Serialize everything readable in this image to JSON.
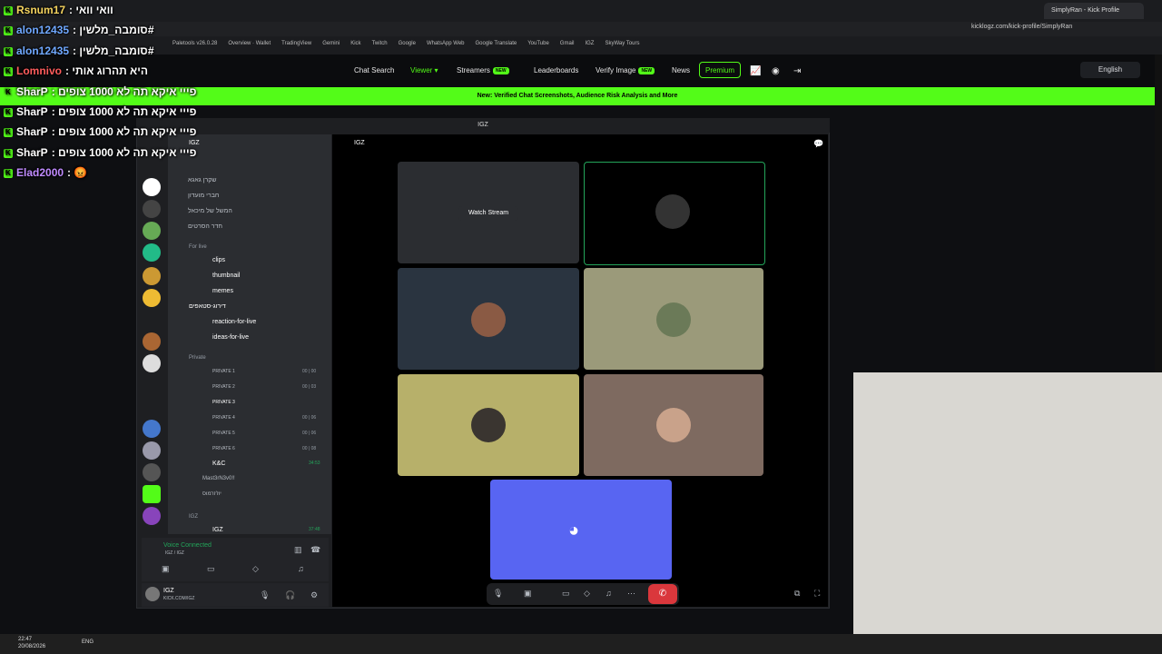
{
  "browser": {
    "tab_title": "SimplyRan - Kick Profile",
    "url": "kicklogz.com/kick-profile/SimplyRan",
    "bookmarks": [
      "Paletools v26.0.28",
      "Overview · Wallet",
      "TradingView",
      "Gemini",
      "Kick",
      "Twitch",
      "Google",
      "WhatsApp Web",
      "Google Translate",
      "YouTube",
      "Gmail",
      "IGZ",
      "SkyWay Tours"
    ]
  },
  "kick_nav": {
    "items": [
      "Chat Search",
      "Viewer",
      "Streamers",
      "Leaderboards",
      "Verify Image",
      "News"
    ],
    "new_badge": "NEW",
    "premium": "Premium",
    "language": "English",
    "banner": "New: Verified Chat Screenshots, Audience Risk Analysis and More"
  },
  "chat": [
    {
      "user": "Rsnum17",
      "message": "וואי וואי",
      "color": "#f4d35e"
    },
    {
      "user": "alon12435",
      "message": "סומבה_מלשין#",
      "color": "#6fa8ff"
    },
    {
      "user": "alon12435",
      "message": "סומבה_מלשין#",
      "color": "#6fa8ff"
    },
    {
      "user": "Lomnivo",
      "message": "היא תהרוג אותי",
      "color": "#ff5c5c"
    },
    {
      "user": "SharP",
      "message": "פייי איקא תה לא 1000 צופים",
      "color": "#ffffff"
    },
    {
      "user": "SharP",
      "message": "פייי איקא תה לא 1000 צופים",
      "color": "#ffffff"
    },
    {
      "user": "SharP",
      "message": "פייי איקא תה לא 1000 צופים",
      "color": "#ffffff"
    },
    {
      "user": "SharP",
      "message": "פייי איקא תה לא 1000 צופים",
      "color": "#ffffff"
    },
    {
      "user": "Elad2000",
      "message": "😡",
      "color": "#c08bff"
    }
  ],
  "discord": {
    "window_title": "IGZ",
    "server_name": "IGZ",
    "channel_header": "IGZ",
    "categories": {
      "live": "For live",
      "private": "Private",
      "igz": "IGZ"
    },
    "top_channels": [
      "שקרן גאגא",
      "חברי מועדון",
      "המשל של מיכאל",
      "חדר הסרטים"
    ],
    "text_channels": [
      "clips",
      "thumbnail",
      "memes",
      "דירוג-סטאפים",
      "reaction-for-live",
      "ideas-for-live"
    ],
    "private_channels": [
      {
        "name": "PRIVATE 1",
        "count": "00 | 00"
      },
      {
        "name": "PRIVATE 2",
        "count": "00 | 03"
      },
      {
        "name": "PRIVATE 3",
        "count": ""
      },
      {
        "name": "PRIVATE 4",
        "count": "00 | 06"
      },
      {
        "name": "PRIVATE 5",
        "count": "00 | 06"
      },
      {
        "name": "PRIVATE 6",
        "count": "00 | 08"
      }
    ],
    "kc": {
      "name": "K&C",
      "time": "34:53",
      "members": [
        "Mast3rN3v0!!",
        "יוז'זרמוס"
      ]
    },
    "igz_voice": {
      "name": "IGZ",
      "time": "37:48"
    },
    "voice_connected": "Voice Connected",
    "voice_location": "IGZ / IGZ",
    "user": {
      "name": "IGZ",
      "status": "KICK.COM/IGZ"
    },
    "watch_stream": "Watch Stream"
  },
  "taskbar": {
    "time": "22:47",
    "date": "20/08/2026",
    "lang": "ENG"
  }
}
